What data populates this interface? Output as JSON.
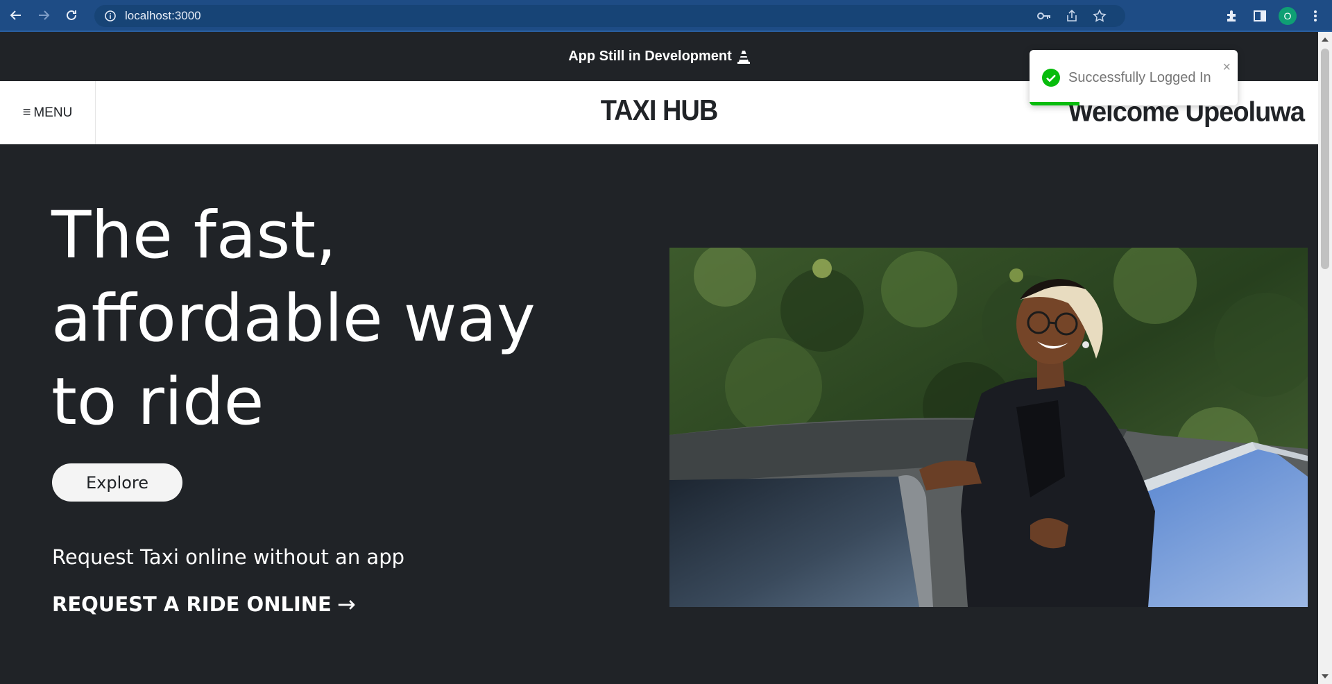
{
  "browser": {
    "url": "localhost:3000",
    "profile_initial": "O",
    "icons": [
      "back-arrow-icon",
      "forward-arrow-icon",
      "reload-icon",
      "site-info-icon",
      "key-icon",
      "share-icon",
      "star-icon",
      "extensions-icon",
      "side-panel-icon",
      "more-vert-icon"
    ]
  },
  "banner": {
    "text": "App Still in Development",
    "icon": "traffic-cone-icon"
  },
  "header": {
    "menu_label": "MENU",
    "brand": "TAXI HUB",
    "welcome": "Welcome Upeoluwa"
  },
  "toast": {
    "message": "Successfully Logged In",
    "close": "×",
    "type_color": "#07bc0c",
    "progress": 0.24
  },
  "hero": {
    "title_line1": "The fast,",
    "title_line2": "affordable way",
    "title_line3": "to ride",
    "explore_label": "Explore",
    "subtitle": "Request Taxi online without an app",
    "cta_label": "REQUEST A RIDE ONLINE",
    "cta_arrow": "→"
  },
  "colors": {
    "background": "#202327",
    "header_bg": "#ffffff",
    "browser_bar": "#1e4c85"
  }
}
